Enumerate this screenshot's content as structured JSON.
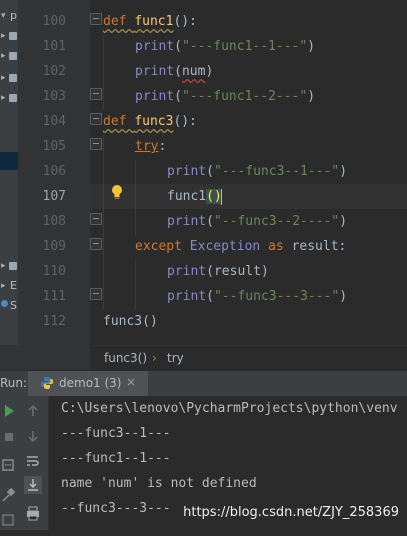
{
  "project_panel": {
    "items": [
      {
        "label": "p"
      },
      {
        "label": ""
      },
      {
        "label": ""
      },
      {
        "label": ""
      },
      {
        "label": ""
      },
      {
        "label": "E"
      },
      {
        "label": "S"
      }
    ]
  },
  "editor": {
    "line_numbers": [
      "100",
      "101",
      "102",
      "103",
      "104",
      "105",
      "106",
      "107",
      "108",
      "109",
      "110",
      "111",
      "112"
    ],
    "lines": {
      "l100": {
        "kw": "def ",
        "fn": "func1",
        "rest": "():"
      },
      "l101": {
        "bi": "print",
        "open": "(",
        "str": "\"---func1--1---\"",
        "close": ")"
      },
      "l102": {
        "bi": "print",
        "open": "(",
        "arg": "num",
        "close": ")"
      },
      "l103": {
        "bi": "print",
        "open": "(",
        "str": "\"---func1--2---\"",
        "close": ")"
      },
      "l104": {
        "kw": "def ",
        "fn": "func3",
        "rest": "():"
      },
      "l105": {
        "kw": "try",
        "rest": ":"
      },
      "l106": {
        "bi": "print",
        "open": "(",
        "str": "\"---func3--1---\"",
        "close": ")"
      },
      "l107": {
        "call": "func1",
        "open": "(",
        "close": ")"
      },
      "l108": {
        "bi": "print",
        "open": "(",
        "str": "\"--func3--2----\"",
        "close": ")"
      },
      "l109": {
        "kw": "except ",
        "cls": "Exception",
        "kw2": " as ",
        "var": "result",
        "rest": ":"
      },
      "l110": {
        "bi": "print",
        "open": "(",
        "arg": "result",
        "close": ")"
      },
      "l111": {
        "bi": "print",
        "open": "(",
        "str": "\"--func3---3---\"",
        "close": ")"
      },
      "l112": {
        "call": "func3",
        "rest": "()"
      }
    }
  },
  "breadcrumb": {
    "item1": "func3()",
    "sep": "›",
    "item2": "try"
  },
  "run": {
    "label": "Run:",
    "tab_title": "demo1 (3)",
    "close": "×"
  },
  "console": {
    "lines": [
      "C:\\Users\\lenovo\\PycharmProjects\\python\\venv",
      "---func3--1---",
      "---func1--1---",
      "name 'num' is not defined",
      "--func3---3---"
    ]
  },
  "watermark": "https://blog.csdn.net/ZJY_258369",
  "colors": {
    "keyword": "#cc7832",
    "function": "#ffc66d",
    "string": "#6a8759",
    "builtin": "#8888c6",
    "text": "#a9b7c6",
    "background": "#2b2b2b"
  },
  "icons": [
    "folder-icon",
    "python-icon",
    "lightbulb-icon",
    "run-icon",
    "stop-icon",
    "up-arrow-icon",
    "down-arrow-icon",
    "wrap-icon",
    "scroll-end-icon",
    "print-icon",
    "settings-icon",
    "pin-icon"
  ]
}
